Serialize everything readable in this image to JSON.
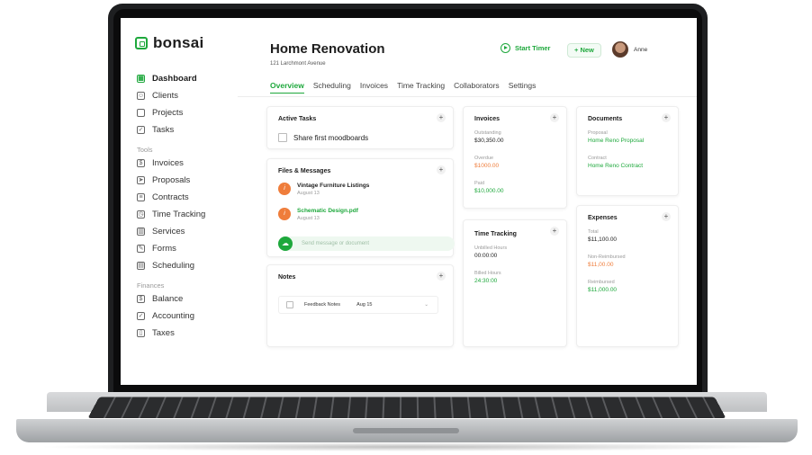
{
  "app": {
    "brand": "bonsai",
    "accent": "#1ea83c"
  },
  "sidebar": {
    "items": [
      {
        "label": "Dashboard",
        "icon": "grid-icon"
      },
      {
        "label": "Clients",
        "icon": "users-icon"
      },
      {
        "label": "Projects",
        "icon": "folder-icon"
      },
      {
        "label": "Tasks",
        "icon": "check-circle-icon"
      }
    ],
    "tools_label": "Tools",
    "tools": [
      {
        "label": "Invoices",
        "icon": "invoice-icon"
      },
      {
        "label": "Proposals",
        "icon": "send-icon"
      },
      {
        "label": "Contracts",
        "icon": "contract-icon"
      },
      {
        "label": "Time Tracking",
        "icon": "clock-icon"
      },
      {
        "label": "Services",
        "icon": "services-icon"
      },
      {
        "label": "Forms",
        "icon": "form-icon"
      },
      {
        "label": "Scheduling",
        "icon": "calendar-icon"
      }
    ],
    "finances_label": "Finances",
    "finances": [
      {
        "label": "Balance",
        "icon": "balance-icon"
      },
      {
        "label": "Accounting",
        "icon": "accounting-icon"
      },
      {
        "label": "Taxes",
        "icon": "taxes-icon"
      }
    ]
  },
  "header": {
    "title": "Home Renovation",
    "address": "121 Larchmont Avenue",
    "start_timer": "Start Timer",
    "new_button": "+ New",
    "user_name": "Anne"
  },
  "tabs": [
    "Overview",
    "Scheduling",
    "Invoices",
    "Time Tracking",
    "Collaborators",
    "Settings"
  ],
  "active_tasks": {
    "title": "Active Tasks",
    "plus": "+",
    "items": [
      "Share first moodboards"
    ]
  },
  "files_messages": {
    "title": "Files & Messages",
    "plus": "+",
    "files": [
      {
        "name": "Vintage Furniture Listings",
        "date": "August 13"
      },
      {
        "name": "Schematic Design.pdf",
        "date": "August 13"
      }
    ],
    "message_placeholder": "Send message or document"
  },
  "notes": {
    "title": "Notes",
    "plus": "+",
    "item": {
      "label": "Feedback Notes",
      "date": "Aug 15",
      "chevron": "⌄"
    }
  },
  "invoices": {
    "title": "Invoices",
    "plus": "+",
    "outstanding_label": "Outstanding",
    "outstanding_value": "$30,350.00",
    "overdue_label": "Overdue",
    "overdue_value": "$1000.00",
    "paid_label": "Paid",
    "paid_value": "$10,000.00"
  },
  "time_tracking": {
    "title": "Time Tracking",
    "plus": "+",
    "unbilled_label": "Unbilled Hours",
    "unbilled_value": "00:00:00",
    "billed_label": "Billed Hours",
    "billed_value": "24:30:00"
  },
  "documents": {
    "title": "Documents",
    "plus": "+",
    "proposal_label": "Proposal",
    "proposal_value": "Home Reno Proposal",
    "contract_label": "Contract",
    "contract_value": "Home Reno Contract"
  },
  "expenses": {
    "title": "Expenses",
    "plus": "+",
    "total_label": "Total",
    "total_value": "$11,100.00",
    "nonreimbursed_label": "Non-Reimbursed",
    "nonreimbursed_value": "$11,00.00",
    "reimbursed_label": "Reimbursed",
    "reimbursed_value": "$11,000.00"
  }
}
